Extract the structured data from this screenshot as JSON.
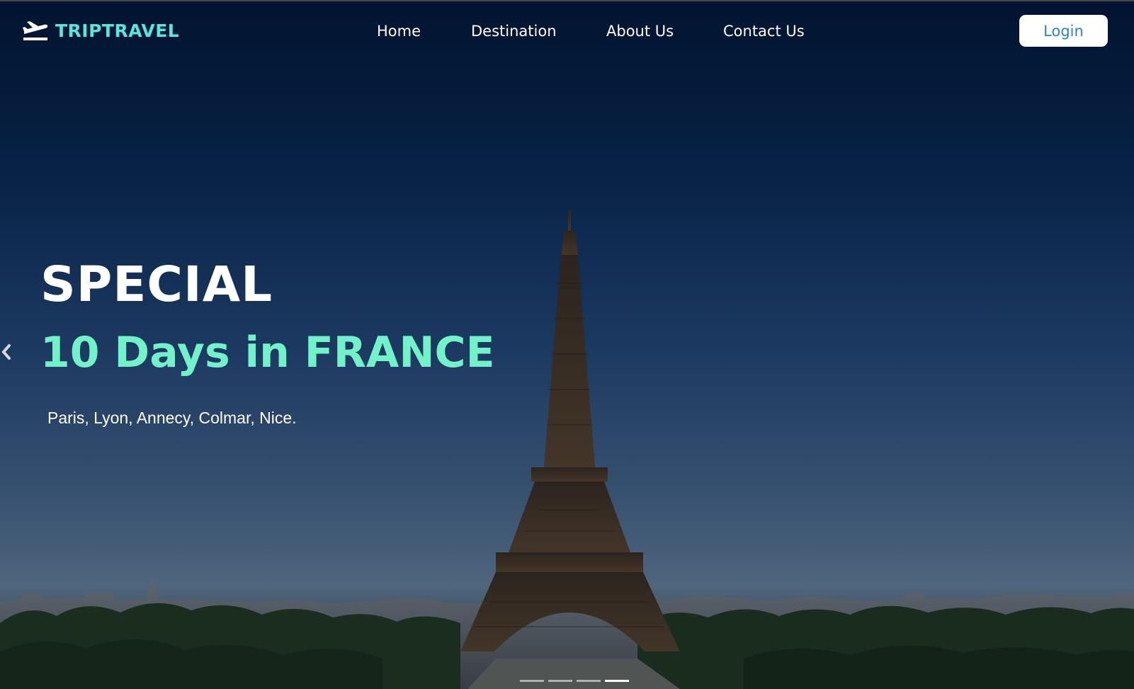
{
  "brand": {
    "name": "TRIPTRAVEL",
    "logo_icon": "plane-takeoff-icon",
    "color": "#5ae4e0"
  },
  "nav": {
    "links": [
      "Home",
      "Destination",
      "About Us",
      "Contact Us"
    ],
    "login_label": "Login"
  },
  "hero": {
    "eyebrow": "SPECIAL",
    "title": "10 Days in FRANCE",
    "subtitle": "Paris, Lyon, Annecy, Colmar, Nice.",
    "title_color": "#72f2c8",
    "background": "eiffel-tower-paris-skyline-photo",
    "prev_icon": "chevron-left-icon"
  },
  "carousel": {
    "slide_count": 4,
    "active_index": 3
  }
}
